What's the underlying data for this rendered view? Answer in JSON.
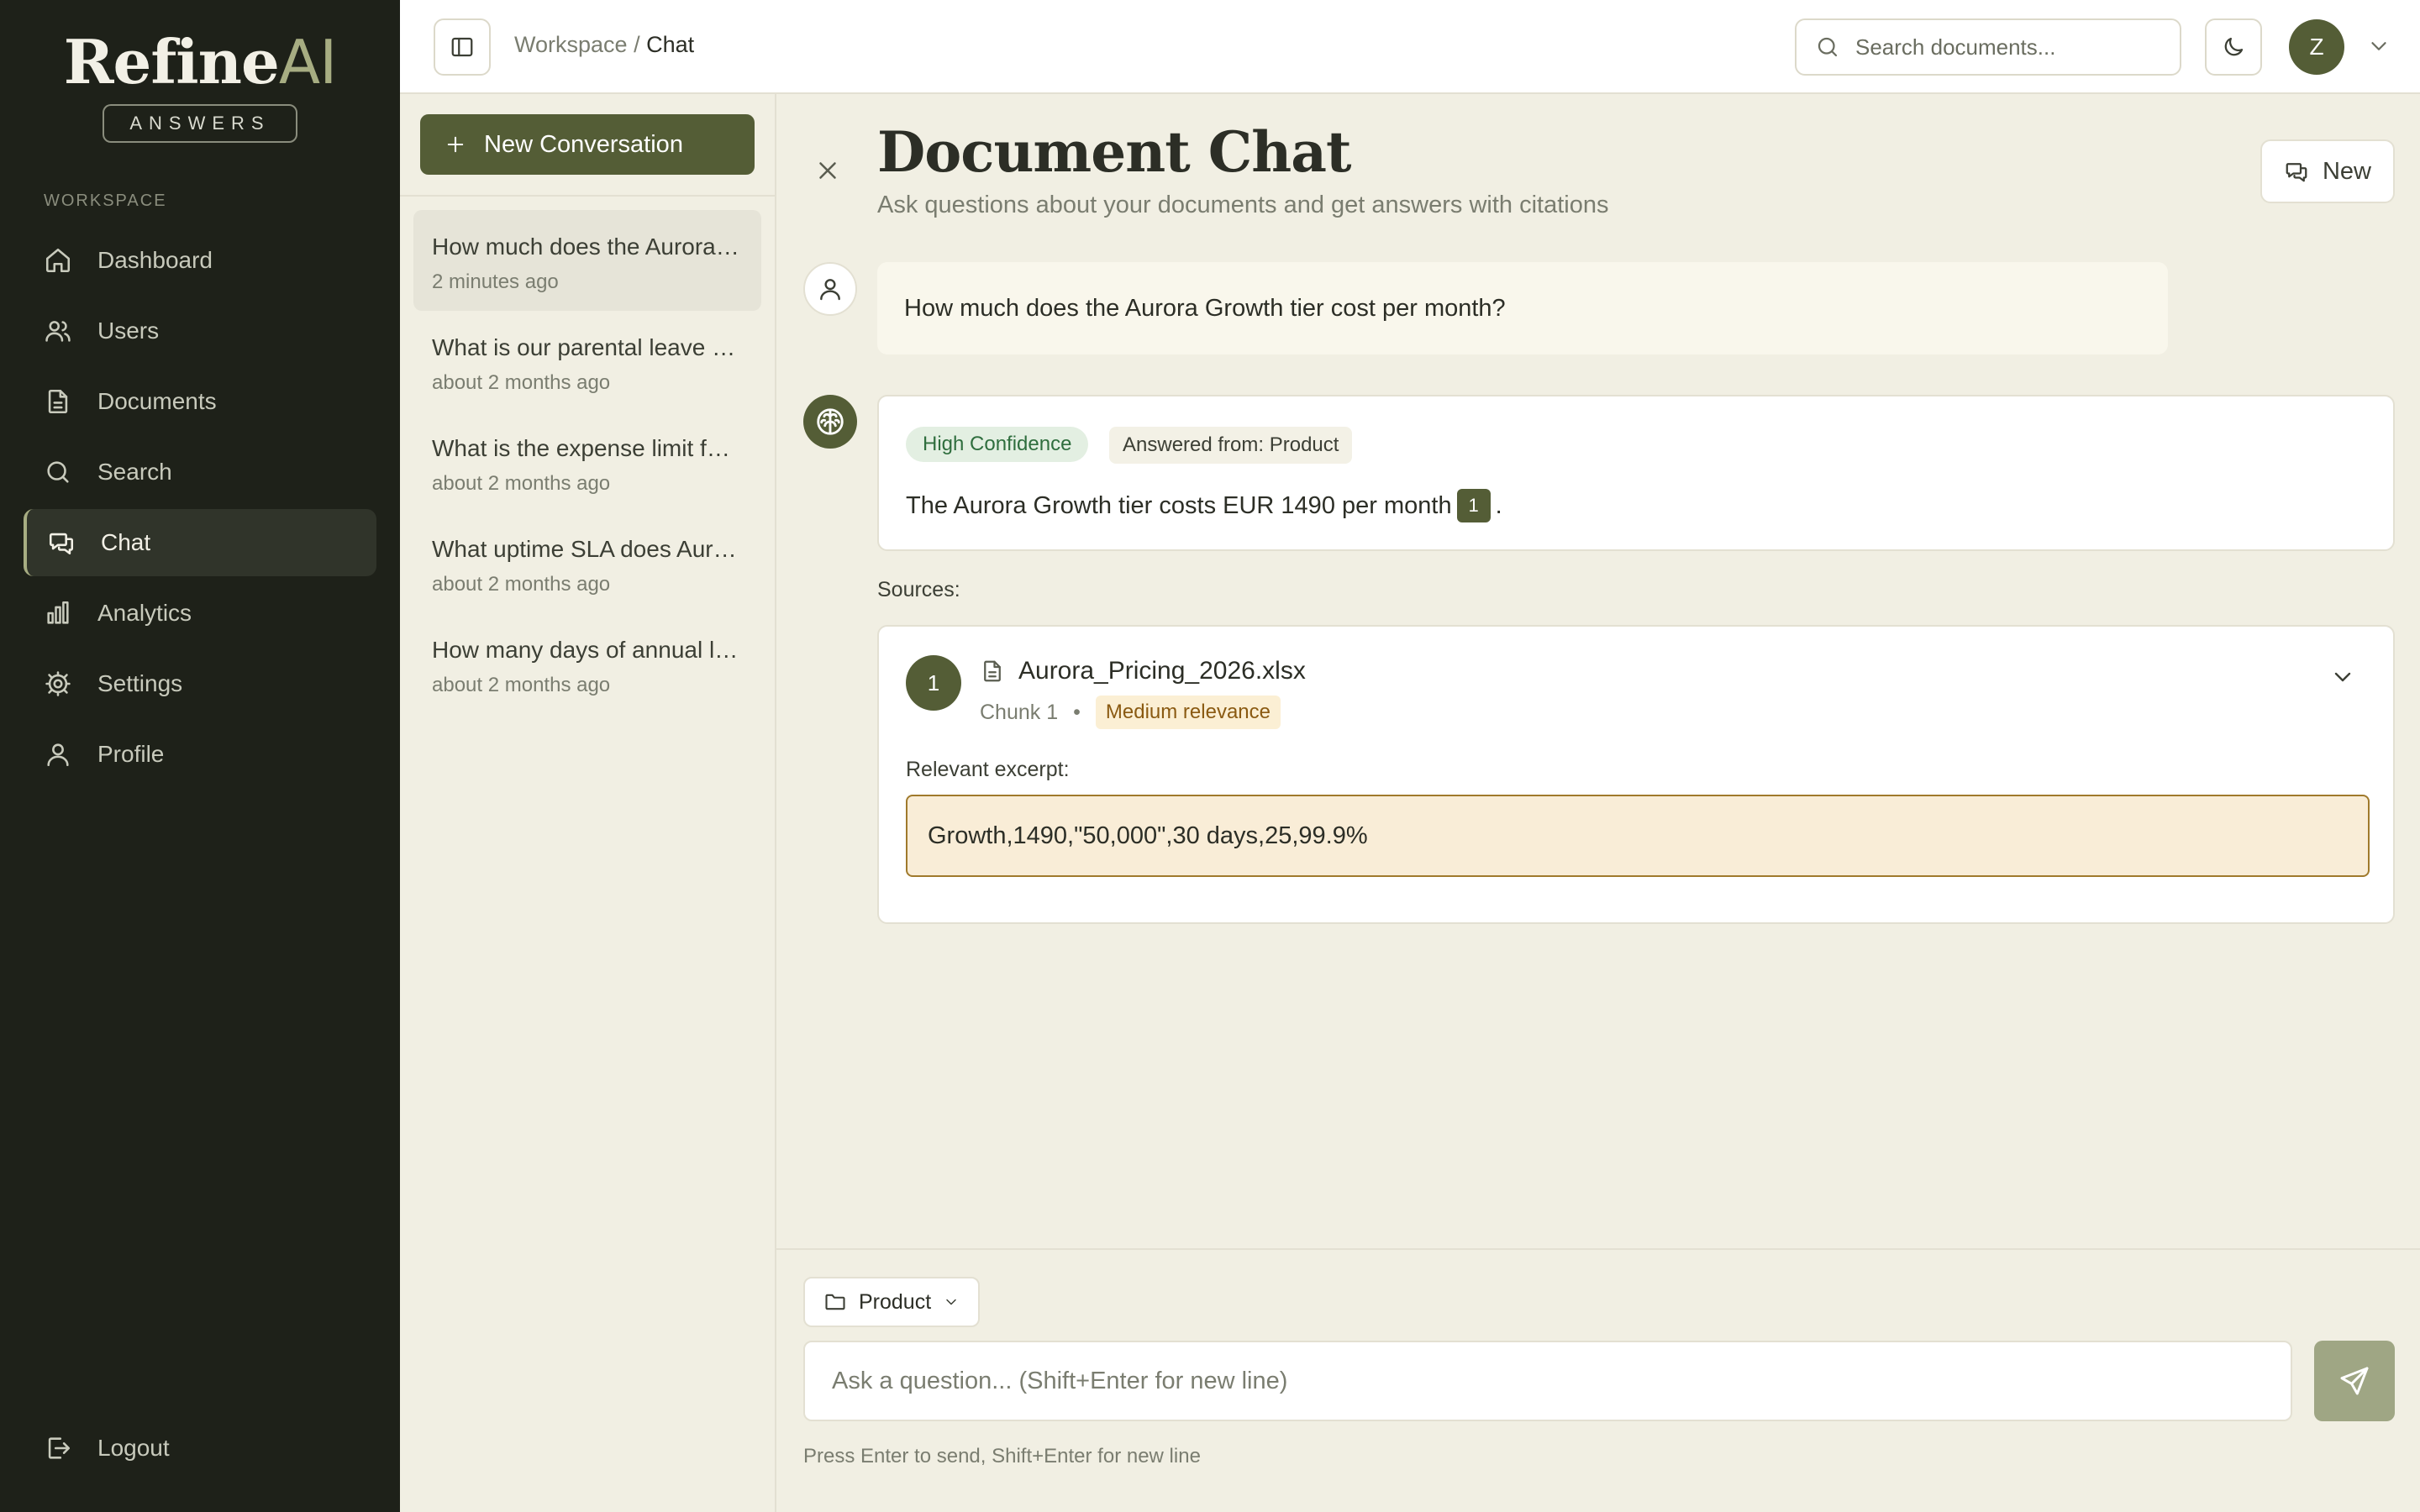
{
  "app": {
    "logo_main": "Refine",
    "logo_accent": "AI",
    "logo_badge": "ANSWERS"
  },
  "sidebar": {
    "section_label": "WORKSPACE",
    "items": [
      {
        "label": "Dashboard",
        "icon": "home-icon"
      },
      {
        "label": "Users",
        "icon": "users-icon"
      },
      {
        "label": "Documents",
        "icon": "document-icon"
      },
      {
        "label": "Search",
        "icon": "search-icon"
      },
      {
        "label": "Chat",
        "icon": "chat-icon",
        "active": true
      },
      {
        "label": "Analytics",
        "icon": "bar-chart-icon"
      },
      {
        "label": "Settings",
        "icon": "gear-icon"
      },
      {
        "label": "Profile",
        "icon": "user-icon"
      }
    ],
    "logout_label": "Logout"
  },
  "topbar": {
    "breadcrumb_root": "Workspace",
    "breadcrumb_sep": "/",
    "breadcrumb_current": "Chat",
    "search_placeholder": "Search documents...",
    "avatar_initial": "Z"
  },
  "conversations": {
    "new_label": "New Conversation",
    "items": [
      {
        "title": "How much does the Aurora Growth tier cost per month?",
        "time": "2 minutes ago",
        "active": true
      },
      {
        "title": "What is our parental leave policy?",
        "time": "about 2 months ago"
      },
      {
        "title": "What is the expense limit for travel?",
        "time": "about 2 months ago"
      },
      {
        "title": "What uptime SLA does Aurora offer?",
        "time": "about 2 months ago"
      },
      {
        "title": "How many days of annual leave do I get?",
        "time": "about 2 months ago"
      }
    ]
  },
  "chat": {
    "title": "Document Chat",
    "subtitle": "Ask questions about your documents and get answers with citations",
    "new_label": "New",
    "user_message": "How much does the Aurora Growth tier cost per month?",
    "answer": {
      "confidence": "High Confidence",
      "source_scope": "Answered from: Product",
      "text": "The Aurora Growth tier costs EUR 1490 per month",
      "citation": "1",
      "end": "."
    },
    "sources_label": "Sources:",
    "sources": [
      {
        "number": "1",
        "file": "Aurora_Pricing_2026.xlsx",
        "chunk": "Chunk 1",
        "separator": "•",
        "relevance": "Medium relevance",
        "excerpt_label": "Relevant excerpt:",
        "excerpt": "Growth,1490,\"50,000\",30 days,25,99.9%"
      }
    ],
    "folder_label": "Product",
    "input_placeholder": "Ask a question... (Shift+Enter for new line)",
    "hint": "Press Enter to send, Shift+Enter for new line"
  },
  "colors": {
    "sidebar_bg": "#1e2119",
    "accent": "#545d36",
    "page_bg": "#f1efe3",
    "high_confidence": "#2f6e3e",
    "medium_relevance": "#8a5a12"
  }
}
